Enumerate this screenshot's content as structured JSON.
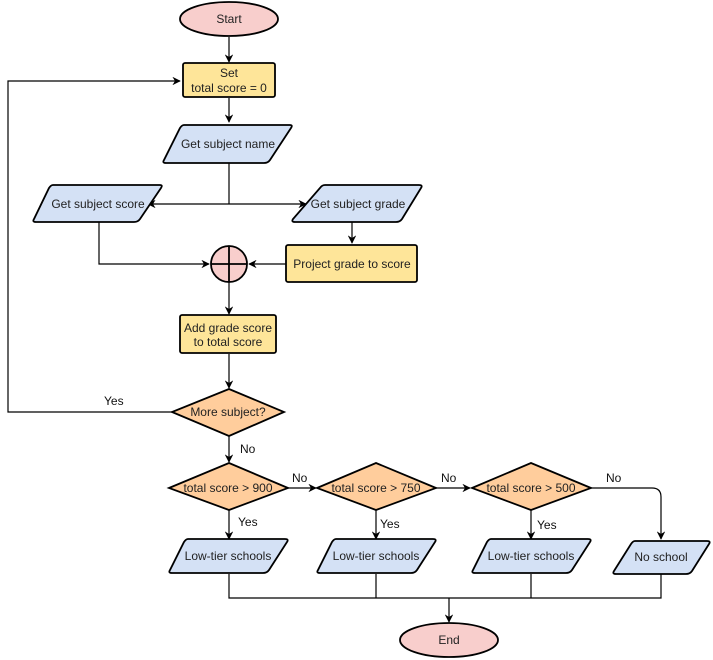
{
  "diagram": {
    "type": "flowchart",
    "colors": {
      "terminal": "#f8cecc",
      "process": "#fee599",
      "io": "#d4e1f5",
      "decision": "#ffcd9c",
      "junction": "#f8cecc",
      "stroke": "#000000"
    },
    "nodes": {
      "start": {
        "label": "Start",
        "shape": "ellipse"
      },
      "set_total": {
        "label_lines": [
          "Set",
          "total score = 0"
        ],
        "shape": "rectangle"
      },
      "get_name": {
        "label": "Get subject name",
        "shape": "parallelogram"
      },
      "get_score": {
        "label": "Get subject score",
        "shape": "parallelogram"
      },
      "get_grade": {
        "label": "Get subject grade",
        "shape": "parallelogram"
      },
      "project": {
        "label": "Project grade to score",
        "shape": "rectangle"
      },
      "junction": {
        "label": "",
        "shape": "summing-junction"
      },
      "add_score": {
        "label_lines": [
          "Add grade score",
          "to total score"
        ],
        "shape": "rectangle"
      },
      "more": {
        "label": "More subject?",
        "shape": "diamond"
      },
      "d900": {
        "label": "total score > 900",
        "shape": "diamond"
      },
      "d750": {
        "label": "total score > 750",
        "shape": "diamond"
      },
      "d500": {
        "label": "total score > 500",
        "shape": "diamond"
      },
      "out1": {
        "label": "Low-tier schools",
        "shape": "parallelogram"
      },
      "out2": {
        "label": "Low-tier schools",
        "shape": "parallelogram"
      },
      "out3": {
        "label": "Low-tier schools",
        "shape": "parallelogram"
      },
      "out4": {
        "label": "No school",
        "shape": "parallelogram"
      },
      "end": {
        "label": "End",
        "shape": "ellipse"
      }
    },
    "edge_labels": {
      "more_yes": "Yes",
      "more_no": "No",
      "d900_no": "No",
      "d900_yes": "Yes",
      "d750_no": "No",
      "d750_yes": "Yes",
      "d500_no": "No",
      "d500_yes": "Yes"
    },
    "edges": [
      [
        "start",
        "set_total"
      ],
      [
        "set_total",
        "get_name"
      ],
      [
        "get_name",
        "get_score"
      ],
      [
        "get_name",
        "get_grade"
      ],
      [
        "get_grade",
        "project"
      ],
      [
        "get_score",
        "junction"
      ],
      [
        "project",
        "junction"
      ],
      [
        "junction",
        "add_score"
      ],
      [
        "add_score",
        "more"
      ],
      [
        "more",
        "set_total",
        "Yes"
      ],
      [
        "more",
        "d900",
        "No"
      ],
      [
        "d900",
        "out1",
        "Yes"
      ],
      [
        "d900",
        "d750",
        "No"
      ],
      [
        "d750",
        "out2",
        "Yes"
      ],
      [
        "d750",
        "d500",
        "No"
      ],
      [
        "d500",
        "out3",
        "Yes"
      ],
      [
        "d500",
        "out4",
        "No"
      ],
      [
        "out1",
        "end"
      ],
      [
        "out2",
        "end"
      ],
      [
        "out3",
        "end"
      ],
      [
        "out4",
        "end"
      ]
    ]
  }
}
